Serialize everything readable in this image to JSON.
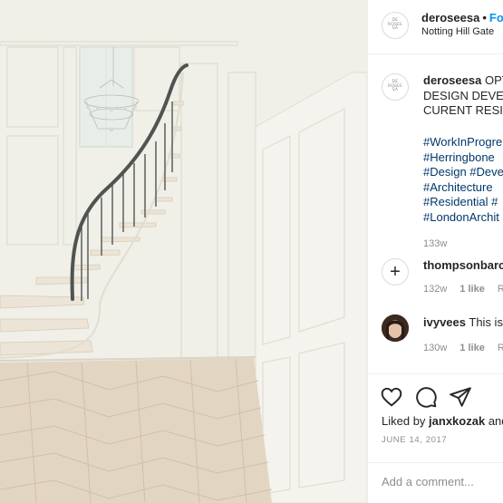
{
  "post": {
    "username": "deroseesa",
    "separator": "•",
    "follow_label": "Fo",
    "location": "Notting Hill Gate",
    "logo_lines": [
      "DE",
      "ROSEE",
      "SA"
    ]
  },
  "caption": {
    "username": "deroseesa",
    "lines": [
      "OPT",
      "DESIGN DEVEL",
      "CURENT RESID"
    ],
    "hashtags": [
      "#WorkInProgre",
      "#Herringbone",
      "#Design #Deve",
      "#Architecture",
      "#Residential #",
      "#LondonArchit"
    ],
    "time": "133w"
  },
  "comments": [
    {
      "username": "thompsonbarc",
      "text": "",
      "time": "132w",
      "likes": "1 like",
      "reply": "R"
    },
    {
      "username": "ivyvees",
      "text": "This is",
      "time": "130w",
      "likes": "1 like",
      "reply": "R"
    }
  ],
  "icons": {
    "add": "add-circle-icon",
    "like": "heart-icon",
    "comment": "comment-icon",
    "share": "paper-plane-icon"
  },
  "likes": {
    "prefix": "Liked by",
    "user": "janxkozak",
    "suffix": "and"
  },
  "date": "JUNE 14, 2017",
  "comment_input": {
    "placeholder": "Add a comment..."
  }
}
